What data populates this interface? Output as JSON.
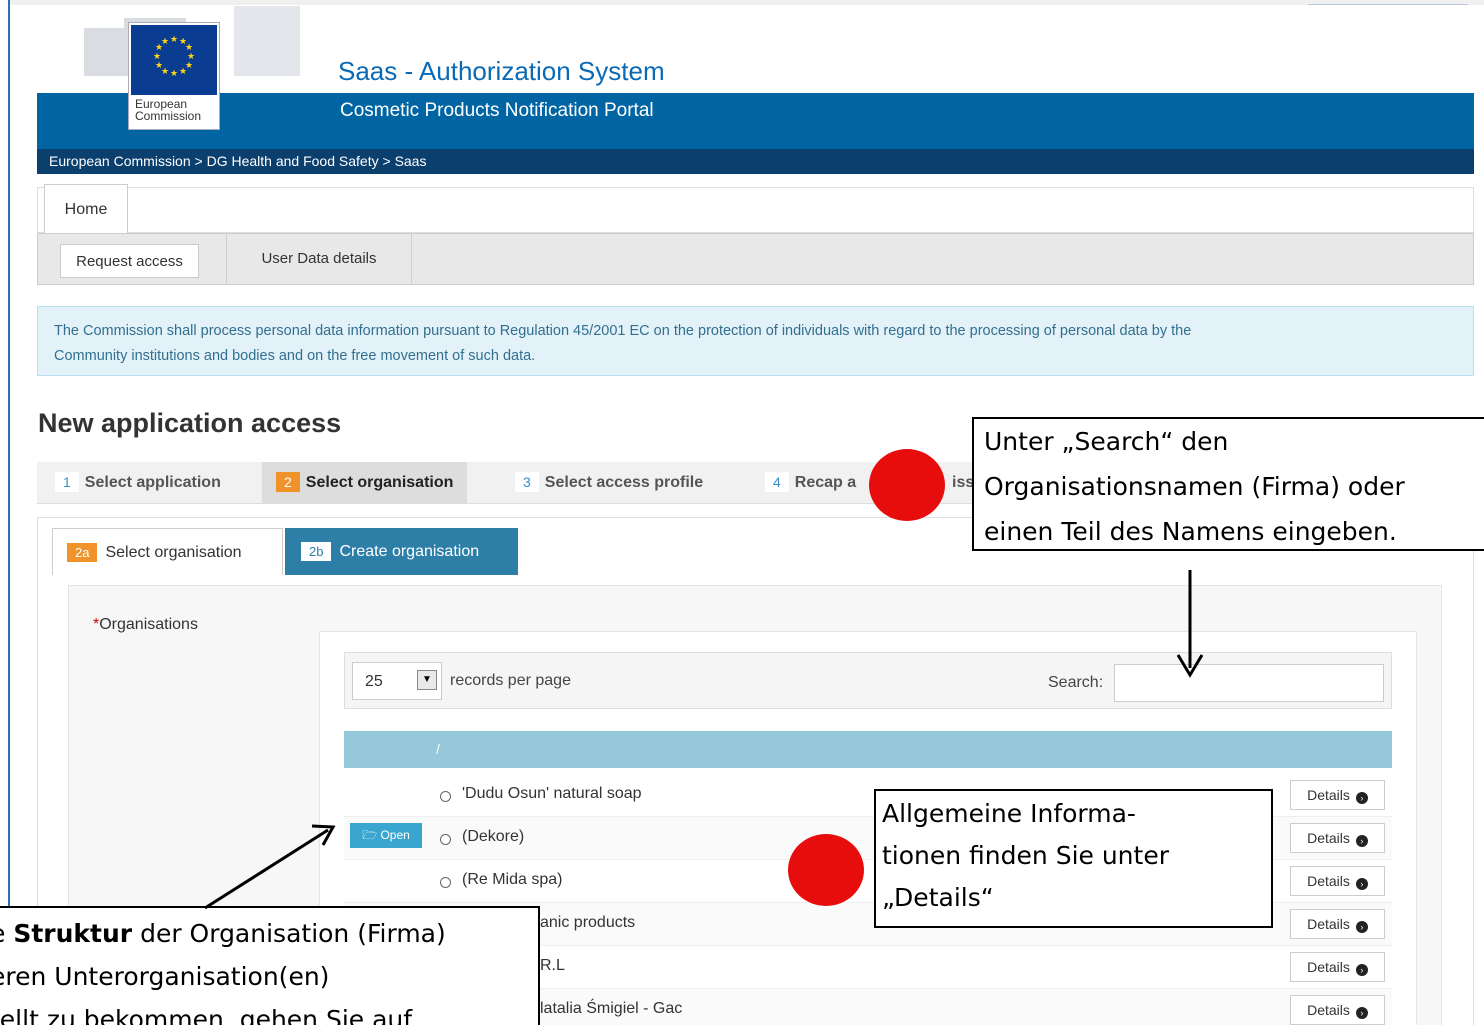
{
  "header": {
    "app_title": "Saas - Authorization System",
    "portal_title": "Cosmetic Products Notification Portal",
    "logo_line1": "European",
    "logo_line2": "Commission",
    "breadcrumb": [
      "European Commission",
      "DG Health and Food Safety",
      "Saas"
    ]
  },
  "nav": {
    "home_tab": "Home",
    "sub_tabs": [
      "Request access",
      "User Data details"
    ]
  },
  "info_text_line1": "The Commission shall process personal data information pursuant to Regulation 45/2001 EC on the protection of individuals with regard to the processing of personal data by the",
  "info_text_line2": "Community institutions and bodies and on the free movement of such data.",
  "page_title": "New application access",
  "steps": [
    {
      "num": "1",
      "label": "Select application"
    },
    {
      "num": "2",
      "label": "Select organisation"
    },
    {
      "num": "3",
      "label": "Select access profile"
    },
    {
      "num": "4",
      "label": "Recap a"
    },
    {
      "num": "",
      "label": "iss"
    }
  ],
  "org_tabs": [
    {
      "num": "2a",
      "label": "Select organisation"
    },
    {
      "num": "2b",
      "label": "Create organisation"
    }
  ],
  "organisations_label": "Organisations",
  "required_mark": "*",
  "table": {
    "page_size": "25",
    "records_per_page": "records per page",
    "search_label": "Search:",
    "search_value": "",
    "header_col": "/",
    "open_label": "Open",
    "details_label": "Details",
    "rows": [
      "'Dudu Osun' natural soap",
      "(Dekore)",
      "(Re Mida spa)",
      "anic products",
      "R.L",
      "latalia Śmigiel - Gac"
    ]
  },
  "annotations": {
    "note1": [
      "Unter „Search“ den",
      "Organisationsnamen (Firma) oder",
      "einen Teil des Namens  eingeben."
    ],
    "note2": [
      "Allgemeine  Informa-",
      "tionen finden Sie unter",
      "„Details“"
    ],
    "note3_prefix": "e ",
    "note3_bold": "Struktur",
    "note3_rest": " der Organisation (Firma)",
    "note3_line2": "eren Unterorganisation(en)",
    "note3_line3": "tellt zu bekommen, gehen Sie auf"
  },
  "colors": {
    "banner": "#0065a2",
    "crumb_bar": "#0b3f6e",
    "accent_orange": "#f0932b",
    "tab_blue": "#2e7fa8",
    "table_header": "#95c8d8",
    "marker_red": "#e80d0d"
  }
}
